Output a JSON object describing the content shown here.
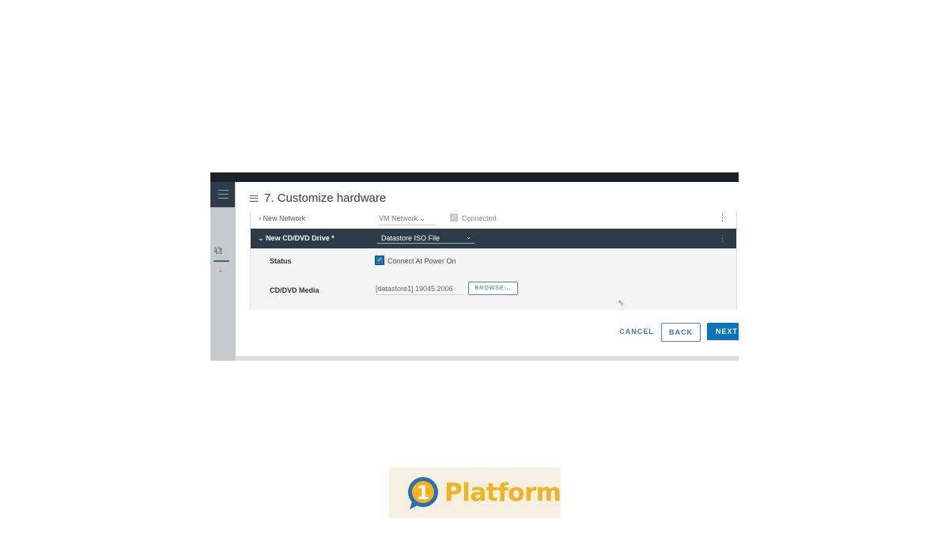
{
  "dialog": {
    "title": "7. Customize hardware",
    "network_row": {
      "expand_glyph": "›",
      "label": "New Network",
      "value": "VM Network",
      "connected_label": "Connected"
    },
    "cd_row": {
      "expand_glyph": "⌄",
      "label": "New CD/DVD Drive *",
      "value": "Datastore ISO File"
    },
    "status": {
      "label": "Status",
      "checkbox_label": "Connect At Power On",
      "checked": true
    },
    "media": {
      "label": "CD/DVD Media",
      "value": "[datastore1] 19045.2006",
      "browse_label": "BROWSE..."
    },
    "buttons": {
      "cancel": "CANCEL",
      "back": "BACK",
      "next": "NEXT"
    }
  },
  "logo": {
    "digit": "1",
    "word": "Platform",
    "color": "#f2b320",
    "accent": "#2a6fb0"
  },
  "colors": {
    "header_row": "#2c3b45",
    "primary": "#0b73b7",
    "nav_top": "#2d3e4a"
  }
}
